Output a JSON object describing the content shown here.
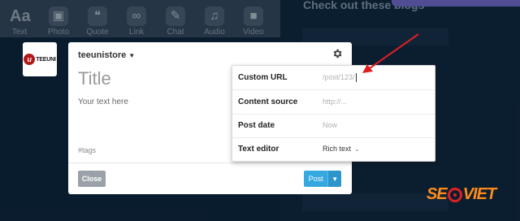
{
  "background": {
    "toolbar": [
      {
        "icon": "text-icon",
        "glyph": "Aa",
        "label": "Text"
      },
      {
        "icon": "photo-icon",
        "glyph": "▣",
        "label": "Photo"
      },
      {
        "icon": "quote-icon",
        "glyph": "❝",
        "label": "Quote"
      },
      {
        "icon": "link-icon",
        "glyph": "∞",
        "label": "Link"
      },
      {
        "icon": "chat-icon",
        "glyph": "✎",
        "label": "Chat"
      },
      {
        "icon": "audio-icon",
        "glyph": "♫",
        "label": "Audio"
      },
      {
        "icon": "video-icon",
        "glyph": "■",
        "label": "Video"
      }
    ],
    "right_title": "Check out these blogs"
  },
  "composer": {
    "blog_name": "teeunistore",
    "avatar_text": "TEEUNI",
    "avatar_letter": "u",
    "title_placeholder": "Title",
    "body_placeholder": "Your text here",
    "tags_placeholder": "#tags",
    "close_label": "Close",
    "post_label": "Post"
  },
  "settings": {
    "rows": [
      {
        "label": "Custom URL",
        "value": "/post/123/"
      },
      {
        "label": "Content source",
        "value": "http://..."
      },
      {
        "label": "Post date",
        "value": "Now"
      },
      {
        "label": "Text editor",
        "value": "Rich text"
      }
    ]
  },
  "watermark": {
    "left": "SE",
    "right": "VIET"
  },
  "colors": {
    "accent": "#35a8e0",
    "annotation_arrow": "#e02020"
  }
}
